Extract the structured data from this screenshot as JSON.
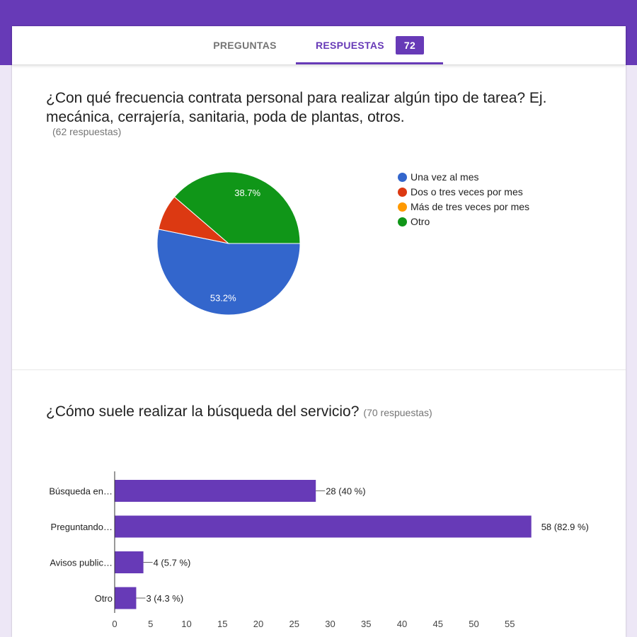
{
  "tabs": {
    "questions_label": "PREGUNTAS",
    "responses_label": "RESPUESTAS",
    "responses_count": "72"
  },
  "questions": [
    {
      "title": "¿Con qué frecuencia contrata personal para realizar algún tipo de tarea? Ej. mecánica, cerrajería, sanitaria, poda de plantas, otros.",
      "count": "(62 respuestas)"
    },
    {
      "title": "¿Cómo suele realizar la búsqueda del servicio?",
      "count": "(70 respuestas)"
    }
  ],
  "colors": {
    "header": "#673ab7",
    "bar": "#673ab7",
    "blue": "#3366cc",
    "red": "#dc3912",
    "orange": "#ff9900",
    "green": "#109618"
  },
  "chart_data": [
    {
      "type": "pie",
      "slices": [
        {
          "label": "Una vez al mes",
          "percent": 53.2,
          "color": "#3366cc",
          "data_label": "53.2%"
        },
        {
          "label": "Dos o tres veces por mes",
          "percent": 8.1,
          "color": "#dc3912",
          "data_label": ""
        },
        {
          "label": "Más de tres veces por mes",
          "percent": 0,
          "color": "#ff9900",
          "data_label": ""
        },
        {
          "label": "Otro",
          "percent": 38.7,
          "color": "#109618",
          "data_label": "38.7%"
        }
      ],
      "legend_position": "right"
    },
    {
      "type": "bar",
      "orientation": "horizontal",
      "categories": [
        "Búsqueda en…",
        "Preguntando…",
        "Avisos public…",
        "Otro"
      ],
      "values": [
        28,
        58,
        4,
        3
      ],
      "data_labels": [
        "28 (40 %)",
        "58 (82.9 %)",
        "4 (5.7 %)",
        "3 (4.3 %)"
      ],
      "xticks": [
        0,
        5,
        10,
        15,
        20,
        25,
        30,
        35,
        40,
        45,
        50,
        55
      ],
      "xlim": [
        0,
        58
      ],
      "color": "#673ab7"
    }
  ]
}
